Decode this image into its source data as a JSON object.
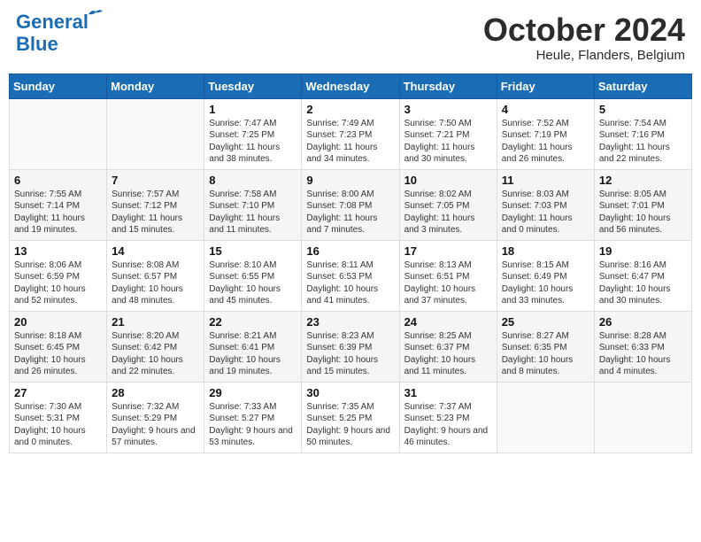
{
  "header": {
    "logo_line1": "General",
    "logo_line2": "Blue",
    "month": "October 2024",
    "location": "Heule, Flanders, Belgium"
  },
  "days_of_week": [
    "Sunday",
    "Monday",
    "Tuesday",
    "Wednesday",
    "Thursday",
    "Friday",
    "Saturday"
  ],
  "weeks": [
    [
      {
        "day": "",
        "info": ""
      },
      {
        "day": "",
        "info": ""
      },
      {
        "day": "1",
        "info": "Sunrise: 7:47 AM\nSunset: 7:25 PM\nDaylight: 11 hours and 38 minutes."
      },
      {
        "day": "2",
        "info": "Sunrise: 7:49 AM\nSunset: 7:23 PM\nDaylight: 11 hours and 34 minutes."
      },
      {
        "day": "3",
        "info": "Sunrise: 7:50 AM\nSunset: 7:21 PM\nDaylight: 11 hours and 30 minutes."
      },
      {
        "day": "4",
        "info": "Sunrise: 7:52 AM\nSunset: 7:19 PM\nDaylight: 11 hours and 26 minutes."
      },
      {
        "day": "5",
        "info": "Sunrise: 7:54 AM\nSunset: 7:16 PM\nDaylight: 11 hours and 22 minutes."
      }
    ],
    [
      {
        "day": "6",
        "info": "Sunrise: 7:55 AM\nSunset: 7:14 PM\nDaylight: 11 hours and 19 minutes."
      },
      {
        "day": "7",
        "info": "Sunrise: 7:57 AM\nSunset: 7:12 PM\nDaylight: 11 hours and 15 minutes."
      },
      {
        "day": "8",
        "info": "Sunrise: 7:58 AM\nSunset: 7:10 PM\nDaylight: 11 hours and 11 minutes."
      },
      {
        "day": "9",
        "info": "Sunrise: 8:00 AM\nSunset: 7:08 PM\nDaylight: 11 hours and 7 minutes."
      },
      {
        "day": "10",
        "info": "Sunrise: 8:02 AM\nSunset: 7:05 PM\nDaylight: 11 hours and 3 minutes."
      },
      {
        "day": "11",
        "info": "Sunrise: 8:03 AM\nSunset: 7:03 PM\nDaylight: 11 hours and 0 minutes."
      },
      {
        "day": "12",
        "info": "Sunrise: 8:05 AM\nSunset: 7:01 PM\nDaylight: 10 hours and 56 minutes."
      }
    ],
    [
      {
        "day": "13",
        "info": "Sunrise: 8:06 AM\nSunset: 6:59 PM\nDaylight: 10 hours and 52 minutes."
      },
      {
        "day": "14",
        "info": "Sunrise: 8:08 AM\nSunset: 6:57 PM\nDaylight: 10 hours and 48 minutes."
      },
      {
        "day": "15",
        "info": "Sunrise: 8:10 AM\nSunset: 6:55 PM\nDaylight: 10 hours and 45 minutes."
      },
      {
        "day": "16",
        "info": "Sunrise: 8:11 AM\nSunset: 6:53 PM\nDaylight: 10 hours and 41 minutes."
      },
      {
        "day": "17",
        "info": "Sunrise: 8:13 AM\nSunset: 6:51 PM\nDaylight: 10 hours and 37 minutes."
      },
      {
        "day": "18",
        "info": "Sunrise: 8:15 AM\nSunset: 6:49 PM\nDaylight: 10 hours and 33 minutes."
      },
      {
        "day": "19",
        "info": "Sunrise: 8:16 AM\nSunset: 6:47 PM\nDaylight: 10 hours and 30 minutes."
      }
    ],
    [
      {
        "day": "20",
        "info": "Sunrise: 8:18 AM\nSunset: 6:45 PM\nDaylight: 10 hours and 26 minutes."
      },
      {
        "day": "21",
        "info": "Sunrise: 8:20 AM\nSunset: 6:42 PM\nDaylight: 10 hours and 22 minutes."
      },
      {
        "day": "22",
        "info": "Sunrise: 8:21 AM\nSunset: 6:41 PM\nDaylight: 10 hours and 19 minutes."
      },
      {
        "day": "23",
        "info": "Sunrise: 8:23 AM\nSunset: 6:39 PM\nDaylight: 10 hours and 15 minutes."
      },
      {
        "day": "24",
        "info": "Sunrise: 8:25 AM\nSunset: 6:37 PM\nDaylight: 10 hours and 11 minutes."
      },
      {
        "day": "25",
        "info": "Sunrise: 8:27 AM\nSunset: 6:35 PM\nDaylight: 10 hours and 8 minutes."
      },
      {
        "day": "26",
        "info": "Sunrise: 8:28 AM\nSunset: 6:33 PM\nDaylight: 10 hours and 4 minutes."
      }
    ],
    [
      {
        "day": "27",
        "info": "Sunrise: 7:30 AM\nSunset: 5:31 PM\nDaylight: 10 hours and 0 minutes."
      },
      {
        "day": "28",
        "info": "Sunrise: 7:32 AM\nSunset: 5:29 PM\nDaylight: 9 hours and 57 minutes."
      },
      {
        "day": "29",
        "info": "Sunrise: 7:33 AM\nSunset: 5:27 PM\nDaylight: 9 hours and 53 minutes."
      },
      {
        "day": "30",
        "info": "Sunrise: 7:35 AM\nSunset: 5:25 PM\nDaylight: 9 hours and 50 minutes."
      },
      {
        "day": "31",
        "info": "Sunrise: 7:37 AM\nSunset: 5:23 PM\nDaylight: 9 hours and 46 minutes."
      },
      {
        "day": "",
        "info": ""
      },
      {
        "day": "",
        "info": ""
      }
    ]
  ]
}
